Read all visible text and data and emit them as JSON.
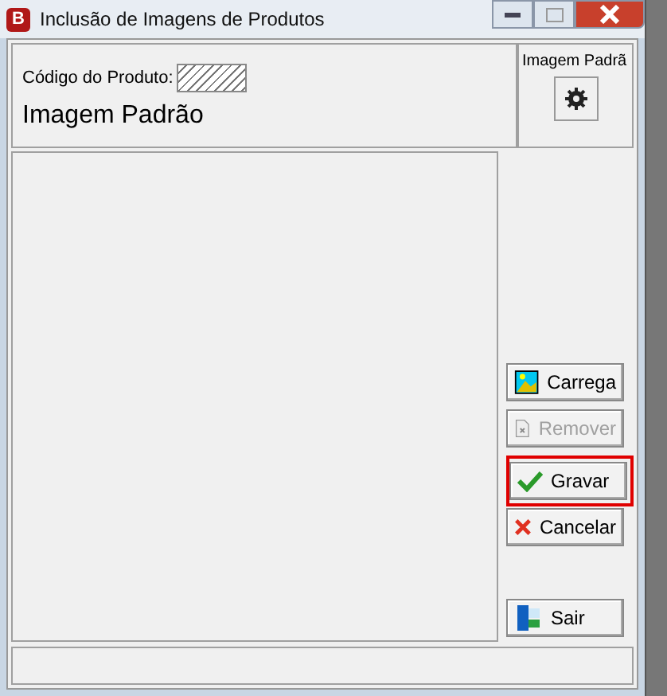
{
  "window": {
    "title": "Inclusão de Imagens de Produtos",
    "logo": "B"
  },
  "product_code": {
    "label": "Código do Produto:"
  },
  "heading": "Imagem Padrão",
  "default_image_panel": {
    "title": "Imagem Padrã"
  },
  "button_groups": [
    {
      "buttons": [
        {
          "label": "Carrega",
          "kind": "load",
          "disabled": false,
          "highlighted": false
        },
        {
          "label": "Remover",
          "kind": "remove",
          "disabled": true,
          "highlighted": false
        }
      ]
    },
    {
      "buttons": [
        {
          "label": "Gravar",
          "kind": "save",
          "disabled": false,
          "highlighted": true
        },
        {
          "label": "Cancelar",
          "kind": "cancel",
          "disabled": false,
          "highlighted": false
        }
      ]
    },
    {
      "buttons": [
        {
          "label": "Sair",
          "kind": "exit",
          "disabled": false,
          "highlighted": false
        }
      ]
    }
  ]
}
